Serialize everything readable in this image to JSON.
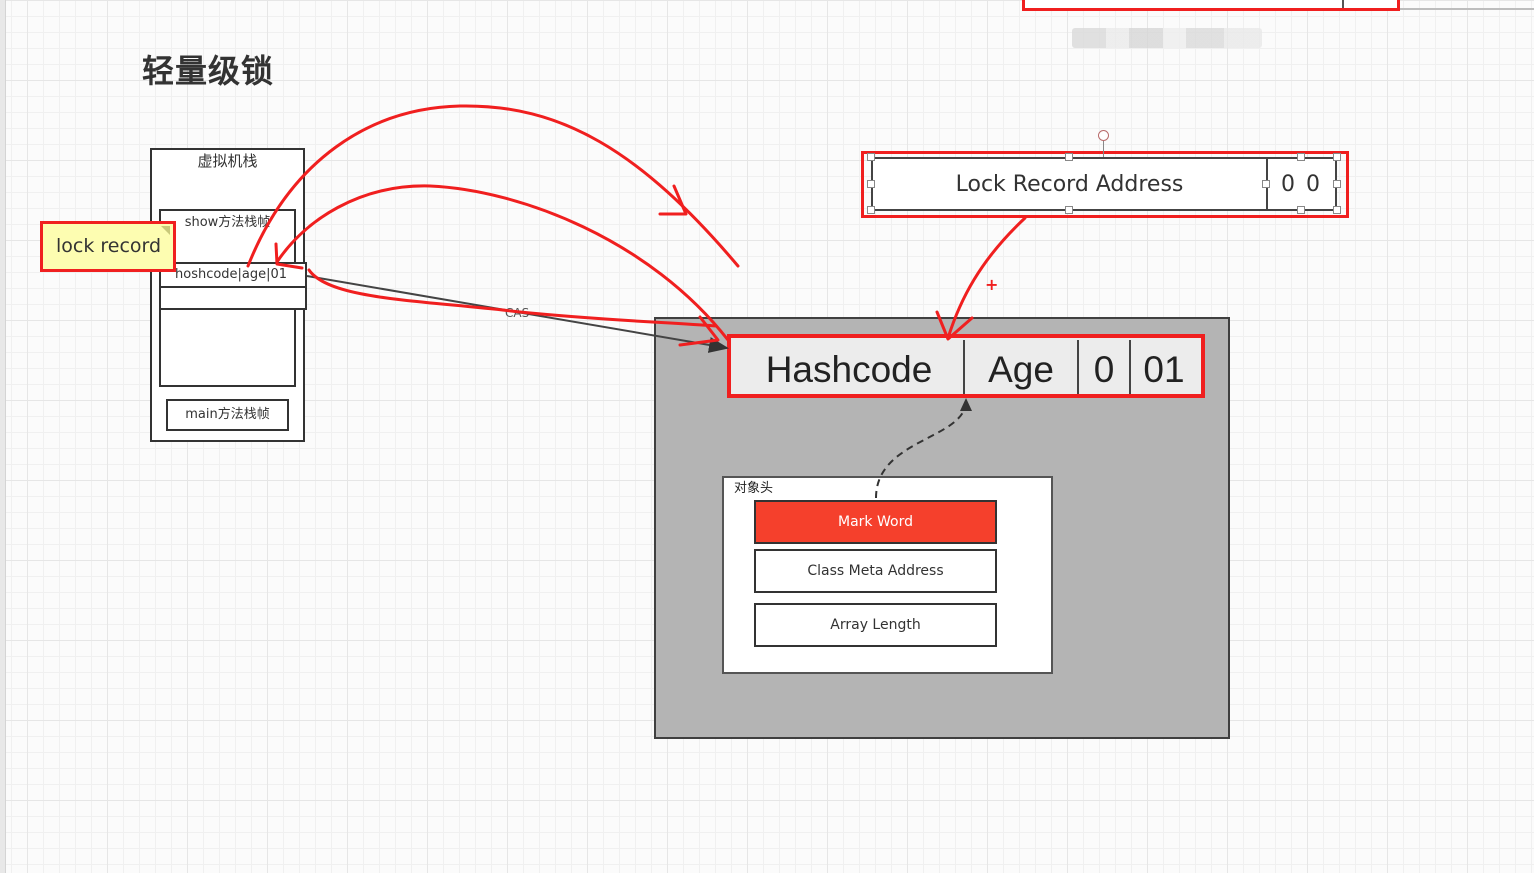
{
  "title": "轻量级锁",
  "jvm_stack": {
    "title": "虚拟机栈",
    "show_frame": "show方法栈帧",
    "hash_row": "hoshcode|age|01",
    "main_frame": "main方法栈帧"
  },
  "lock_record_note": "lock record",
  "lock_record_address": {
    "label": "Lock Record Address",
    "bits": "0 0"
  },
  "mark_word_fields": [
    "Hashcode",
    "Age",
    "0",
    "01"
  ],
  "object_header": {
    "title": "对象头",
    "rows": [
      "Mark Word",
      "Class Meta Address",
      "Array Length"
    ]
  },
  "cas_label": "CAS",
  "plus_marker": "+",
  "colors": {
    "annotation_red": "#f01f1f",
    "mark_word_fill": "#f5402c",
    "note_yellow": "#fdfdb1",
    "object_gray": "#b4b4b4"
  }
}
